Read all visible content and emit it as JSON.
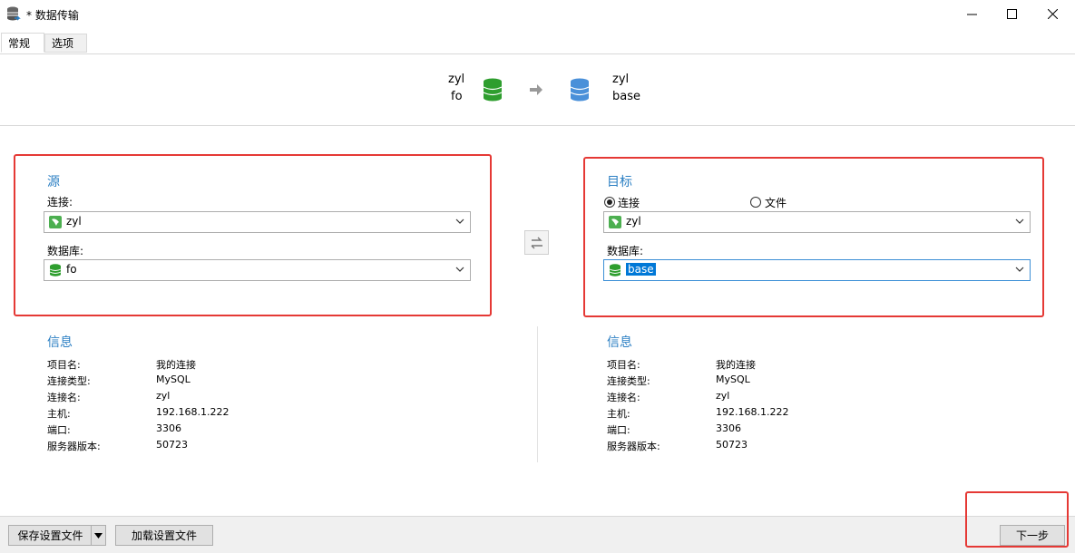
{
  "window": {
    "title": "* 数据传输",
    "minimize": "—",
    "maximize": "☐",
    "close": "✕"
  },
  "tabs": [
    {
      "label": "常规",
      "active": true
    },
    {
      "label": "选项",
      "active": false
    }
  ],
  "header": {
    "source_connection": "zyl",
    "source_database": "fo",
    "target_connection": "zyl",
    "target_database": "base"
  },
  "source": {
    "title": "源",
    "connection_label": "连接:",
    "connection_value": "zyl",
    "database_label": "数据库:",
    "database_value": "fo"
  },
  "target": {
    "title": "目标",
    "radio_connection": "连接",
    "radio_file": "文件",
    "selected_mode": "连接",
    "connection_value": "zyl",
    "database_label": "数据库:",
    "database_value": "base"
  },
  "source_info": {
    "title": "信息",
    "rows": [
      {
        "key": "项目名:",
        "value": "我的连接"
      },
      {
        "key": "连接类型:",
        "value": "MySQL"
      },
      {
        "key": "连接名:",
        "value": "zyl"
      },
      {
        "key": "主机:",
        "value": "192.168.1.222"
      },
      {
        "key": "端口:",
        "value": "3306"
      },
      {
        "key": "服务器版本:",
        "value": "50723"
      }
    ]
  },
  "target_info": {
    "title": "信息",
    "rows": [
      {
        "key": "项目名:",
        "value": "我的连接"
      },
      {
        "key": "连接类型:",
        "value": "MySQL"
      },
      {
        "key": "连接名:",
        "value": "zyl"
      },
      {
        "key": "主机:",
        "value": "192.168.1.222"
      },
      {
        "key": "端口:",
        "value": "3306"
      },
      {
        "key": "服务器版本:",
        "value": "50723"
      }
    ]
  },
  "footer": {
    "save_settings": "保存设置文件",
    "load_settings": "加载设置文件",
    "next": "下一步"
  },
  "colors": {
    "accent_blue": "#2b7fc3",
    "source_db_green": "#2e9e2e",
    "target_db_blue": "#4a90d9",
    "annotation_red": "#e53935"
  }
}
